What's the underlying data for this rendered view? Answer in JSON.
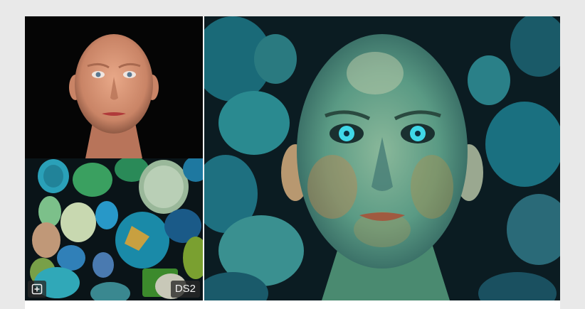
{
  "result": {
    "model_badge": "DS2",
    "icons": {
      "expand": "expand-square-icon"
    },
    "colors": {
      "background": "#e9e9e9",
      "card": "#ffffff",
      "overlay": "#282828"
    }
  }
}
